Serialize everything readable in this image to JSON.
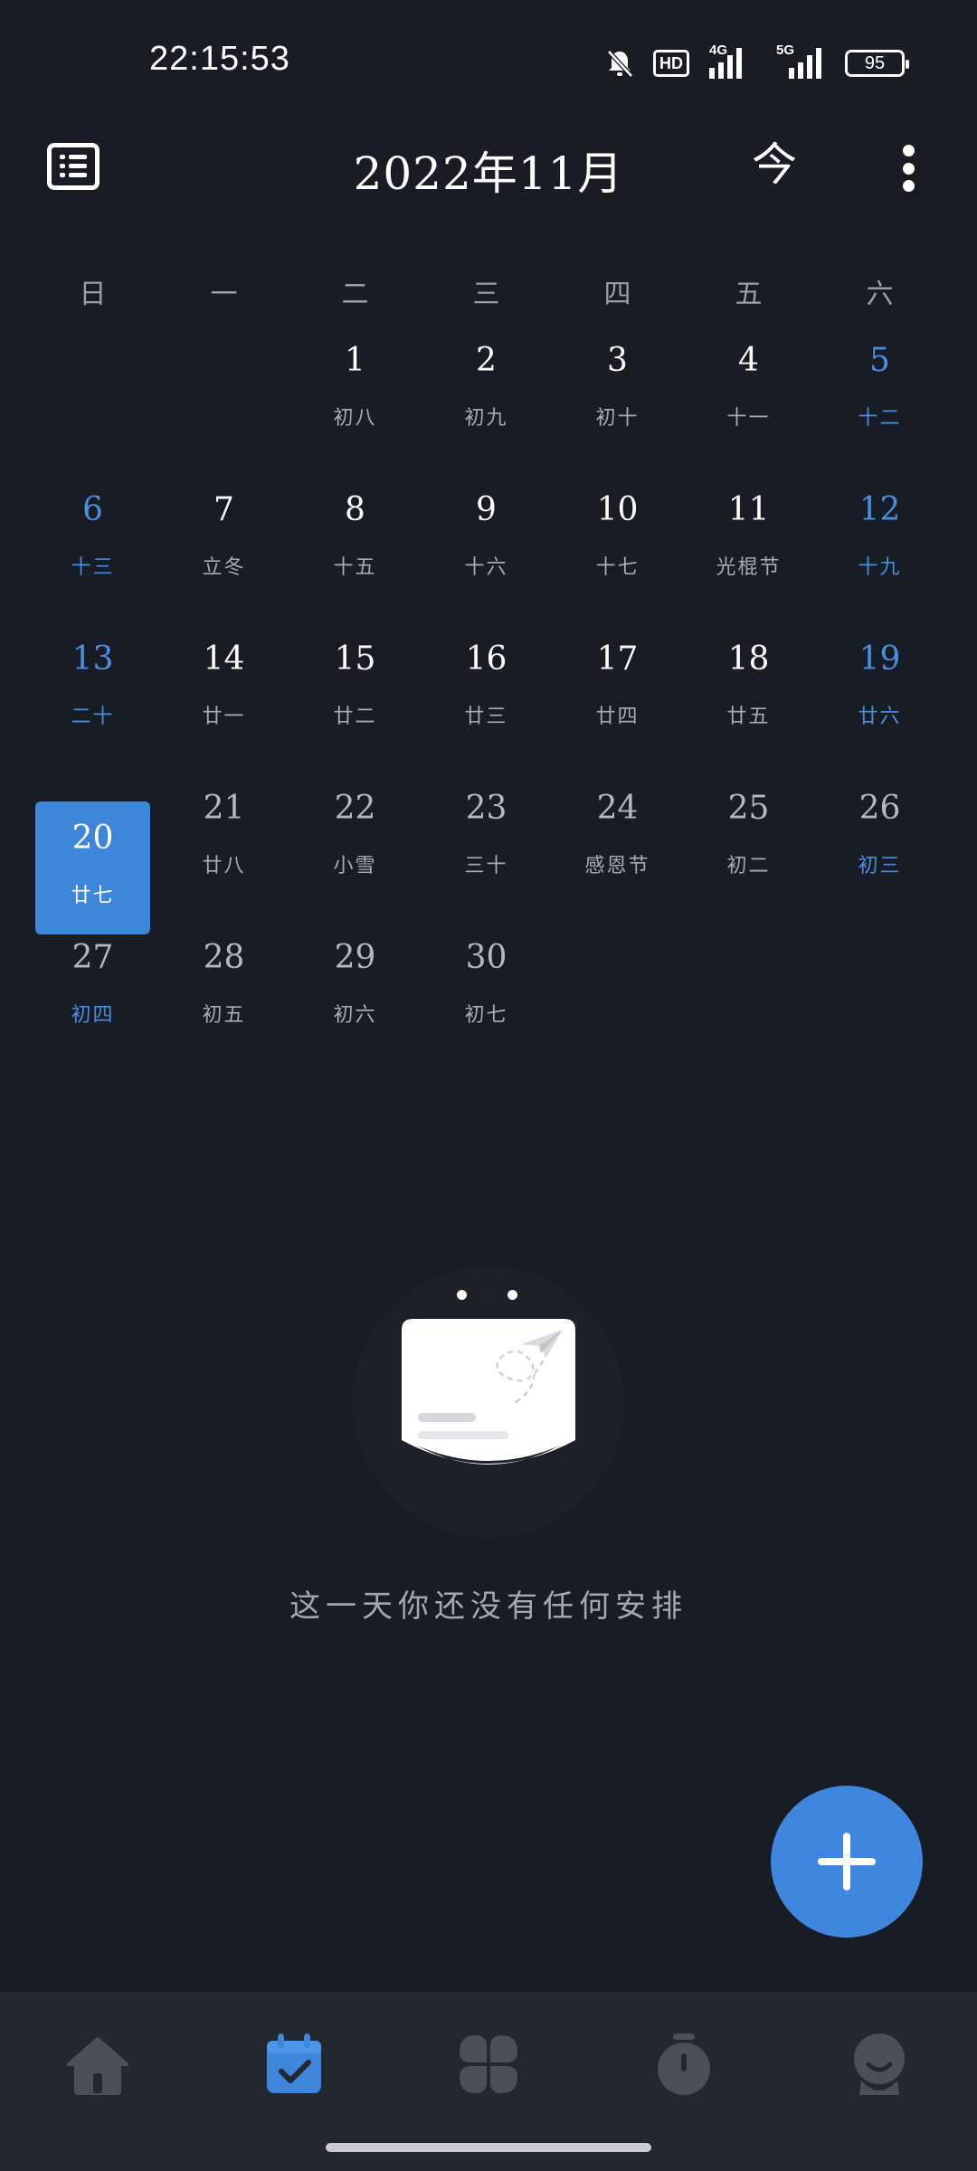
{
  "status_bar": {
    "time": "22:15:53",
    "hd_label": "HD",
    "network_1": "4G",
    "network_2": "5G",
    "battery": "95"
  },
  "header": {
    "month_title": "2022年11月",
    "today_icon": "今"
  },
  "weekdays": [
    "日",
    "一",
    "二",
    "三",
    "四",
    "五",
    "六"
  ],
  "calendar": {
    "days": [
      {
        "n": "1",
        "l": "初八"
      },
      {
        "n": "2",
        "l": "初九"
      },
      {
        "n": "3",
        "l": "初十"
      },
      {
        "n": "4",
        "l": "十一"
      },
      {
        "n": "5",
        "l": "十二"
      },
      {
        "n": "6",
        "l": "十三"
      },
      {
        "n": "7",
        "l": "立冬"
      },
      {
        "n": "8",
        "l": "十五"
      },
      {
        "n": "9",
        "l": "十六"
      },
      {
        "n": "10",
        "l": "十七"
      },
      {
        "n": "11",
        "l": "光棍节"
      },
      {
        "n": "12",
        "l": "十九"
      },
      {
        "n": "13",
        "l": "二十"
      },
      {
        "n": "14",
        "l": "廿一"
      },
      {
        "n": "15",
        "l": "廿二"
      },
      {
        "n": "16",
        "l": "廿三"
      },
      {
        "n": "17",
        "l": "廿四"
      },
      {
        "n": "18",
        "l": "廿五"
      },
      {
        "n": "19",
        "l": "廿六"
      },
      {
        "n": "20",
        "l": "廿七"
      },
      {
        "n": "21",
        "l": "廿八"
      },
      {
        "n": "22",
        "l": "小雪"
      },
      {
        "n": "23",
        "l": "三十"
      },
      {
        "n": "24",
        "l": "感恩节"
      },
      {
        "n": "25",
        "l": "初二"
      },
      {
        "n": "26",
        "l": "初三"
      },
      {
        "n": "27",
        "l": "初四"
      },
      {
        "n": "28",
        "l": "初五"
      },
      {
        "n": "29",
        "l": "初六"
      },
      {
        "n": "30",
        "l": "初七"
      }
    ],
    "selected_day": "20"
  },
  "empty_state": {
    "message": "这一天你还没有任何安排"
  },
  "fab": {
    "icon": "plus-icon"
  },
  "bottom_nav": {
    "items": [
      {
        "icon": "home-icon",
        "active": false
      },
      {
        "icon": "calendar-check-icon",
        "active": true
      },
      {
        "icon": "grid-apps-icon",
        "active": false
      },
      {
        "icon": "timer-icon",
        "active": false
      },
      {
        "icon": "profile-icon",
        "active": false
      }
    ]
  },
  "colors": {
    "background": "#181c24",
    "accent": "#3d86dc",
    "nav_background": "#222730",
    "muted_icon": "#4a505a"
  }
}
